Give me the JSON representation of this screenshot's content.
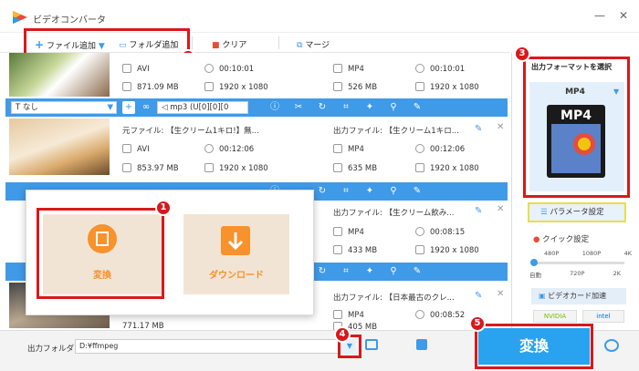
{
  "app": {
    "title": "ビデオコンバータ",
    "close": "✕",
    "minimize": "—"
  },
  "toolbar": {
    "add_file": "ファイル追加",
    "add_folder": "フォルダ追加",
    "clear": "クリア",
    "merge": "マージ"
  },
  "files": [
    {
      "src_name": "",
      "src_fmt": "AVI",
      "src_dur": "00:10:01",
      "src_size": "871.09 MB",
      "src_res": "1920 x 1080",
      "out_name": "",
      "out_fmt": "MP4",
      "out_dur": "00:10:01",
      "out_size": "526 MB",
      "out_res": "1920 x 1080"
    },
    {
      "src_name": "元ファイル: 【生クリーム1キロ!】無...",
      "src_fmt": "AVI",
      "src_dur": "00:12:06",
      "src_size": "853.97 MB",
      "src_res": "1920 x 1080",
      "out_name": "出力ファイル: 【生クリーム1キロ...",
      "out_fmt": "MP4",
      "out_dur": "00:12:06",
      "out_size": "635 MB",
      "out_res": "1920 x 1080"
    },
    {
      "src_name": "",
      "src_fmt": "",
      "src_dur": "",
      "src_size": "",
      "src_res": "",
      "out_name": "出力ファイル: 【生クリーム飲み...",
      "out_fmt": "MP4",
      "out_dur": "00:08:15",
      "out_size": "433 MB",
      "out_res": "1920 x 1080"
    },
    {
      "src_name": "",
      "src_fmt": "",
      "src_dur": "",
      "src_size": "771.17 MB",
      "src_res": "",
      "out_name": "出力ファイル: 【日本最古のクレ...",
      "out_fmt": "MP4",
      "out_dur": "00:08:52",
      "out_size": "405 MB",
      "out_res": ""
    }
  ],
  "bar": {
    "subtitle": "なし",
    "audio": "mp3 (U[0][0][0"
  },
  "popup": {
    "convert": "変換",
    "download": "ダウンロード"
  },
  "right": {
    "output_format_label": "出力フォーマットを選択",
    "format": "MP4",
    "param": "パラメータ設定",
    "quick": "クイック設定",
    "res_top": [
      "480P",
      "1080P",
      "4K"
    ],
    "res_bottom": [
      "自動",
      "720P",
      "2K"
    ],
    "gpu": "ビデオカード加速",
    "nvidia": "NVIDIA",
    "intel": "intel"
  },
  "bottom": {
    "folder_label": "出力フォルダ:",
    "folder_path": "D:¥ffmpeg",
    "convert": "変換"
  },
  "badges": [
    "1",
    "2",
    "3",
    "4",
    "5"
  ],
  "colors": {
    "accent": "#3f9ae8",
    "highlight": "#d7191c",
    "convert_btn": "#29a3ef",
    "popup_tile": "#f7922c"
  }
}
